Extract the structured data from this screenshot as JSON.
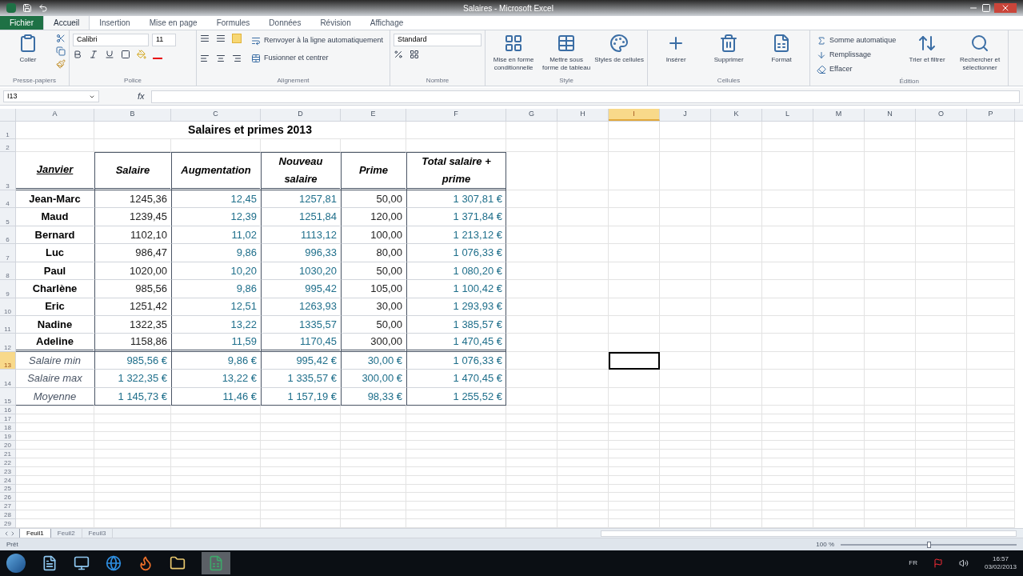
{
  "window": {
    "title": "Salaires - Microsoft Excel"
  },
  "ribbon": {
    "tabs": [
      {
        "label": "Fichier",
        "selected": false,
        "kind": "file"
      },
      {
        "label": "Accueil",
        "selected": true,
        "kind": "tab"
      },
      {
        "label": "Insertion",
        "selected": false,
        "kind": "tab"
      },
      {
        "label": "Mise en page",
        "selected": false,
        "kind": "tab"
      },
      {
        "label": "Formules",
        "selected": false,
        "kind": "tab"
      },
      {
        "label": "Données",
        "selected": false,
        "kind": "tab"
      },
      {
        "label": "Révision",
        "selected": false,
        "kind": "tab"
      },
      {
        "label": "Affichage",
        "selected": false,
        "kind": "tab"
      }
    ],
    "clipboard": {
      "paste": "Coller",
      "group": "Presse-papiers"
    },
    "font": {
      "name": "Calibri",
      "size": "11",
      "group": "Police"
    },
    "alignment": {
      "wrap": "Renvoyer à la ligne automatiquement",
      "merge": "Fusionner et centrer",
      "group": "Alignement"
    },
    "number": {
      "format": "Standard",
      "group": "Nombre"
    },
    "styles": {
      "buttons": [
        "Mise en forme conditionnelle",
        "Mettre sous forme de tableau",
        "Styles de cellules"
      ],
      "group": "Style"
    },
    "cells": {
      "buttons": [
        "Insérer",
        "Supprimer",
        "Format"
      ],
      "group": "Cellules"
    },
    "editing": {
      "commands": [
        "Somme automatique",
        "Remplissage",
        "Effacer"
      ],
      "buttons": [
        "Trier et filtrer",
        "Rechercher et sélectionner"
      ],
      "group": "Édition"
    }
  },
  "formula_bar": {
    "name_box": "I13",
    "function_label": "fx"
  },
  "grid": {
    "columns": [
      {
        "label": "A",
        "selected": false
      },
      {
        "label": "B",
        "selected": false
      },
      {
        "label": "C",
        "selected": false
      },
      {
        "label": "D",
        "selected": false
      },
      {
        "label": "E",
        "selected": false
      },
      {
        "label": "F",
        "selected": false
      },
      {
        "label": "G",
        "selected": false
      },
      {
        "label": "H",
        "selected": false
      },
      {
        "label": "I",
        "selected": true
      },
      {
        "label": "J",
        "selected": false
      },
      {
        "label": "K",
        "selected": false
      },
      {
        "label": "L",
        "selected": false
      },
      {
        "label": "M",
        "selected": false
      },
      {
        "label": "N",
        "selected": false
      },
      {
        "label": "O",
        "selected": false
      },
      {
        "label": "P",
        "selected": false
      }
    ],
    "computed_columns": [
      false,
      false,
      true,
      true,
      false,
      true
    ],
    "rows": [
      {
        "label": "1",
        "selected": false,
        "kind": "title",
        "cells": [
          "Salaires et primes 2013"
        ]
      },
      {
        "label": "2",
        "selected": false,
        "kind": "empty"
      },
      {
        "label": "3",
        "selected": false,
        "kind": "header",
        "cells": [
          "Janvier",
          "Salaire",
          "Augmentation",
          "Nouveau salaire",
          "Prime",
          "Total salaire + prime"
        ]
      },
      {
        "label": "4",
        "selected": false,
        "kind": "data",
        "cells": [
          "Jean-Marc",
          "1245,36",
          "12,45",
          "1257,81",
          "50,00",
          "1 307,81 €"
        ]
      },
      {
        "label": "5",
        "selected": false,
        "kind": "data",
        "cells": [
          "Maud",
          "1239,45",
          "12,39",
          "1251,84",
          "120,00",
          "1 371,84 €"
        ]
      },
      {
        "label": "6",
        "selected": false,
        "kind": "data",
        "cells": [
          "Bernard",
          "1102,10",
          "11,02",
          "1113,12",
          "100,00",
          "1 213,12 €"
        ]
      },
      {
        "label": "7",
        "selected": false,
        "kind": "data",
        "cells": [
          "Luc",
          "986,47",
          "9,86",
          "996,33",
          "80,00",
          "1 076,33 €"
        ]
      },
      {
        "label": "8",
        "selected": false,
        "kind": "data",
        "cells": [
          "Paul",
          "1020,00",
          "10,20",
          "1030,20",
          "50,00",
          "1 080,20 €"
        ]
      },
      {
        "label": "9",
        "selected": false,
        "kind": "data",
        "cells": [
          "Charlène",
          "985,56",
          "9,86",
          "995,42",
          "105,00",
          "1 100,42 €"
        ]
      },
      {
        "label": "10",
        "selected": false,
        "kind": "data",
        "cells": [
          "Eric",
          "1251,42",
          "12,51",
          "1263,93",
          "30,00",
          "1 293,93 €"
        ]
      },
      {
        "label": "11",
        "selected": false,
        "kind": "data",
        "cells": [
          "Nadine",
          "1322,35",
          "13,22",
          "1335,57",
          "50,00",
          "1 385,57 €"
        ]
      },
      {
        "label": "12",
        "selected": false,
        "kind": "data",
        "cells": [
          "Adeline",
          "1158,86",
          "11,59",
          "1170,45",
          "300,00",
          "1 470,45 €"
        ]
      },
      {
        "label": "13",
        "selected": true,
        "kind": "summary",
        "cells": [
          "Salaire min",
          "985,56 €",
          "9,86 €",
          "995,42 €",
          "30,00 €",
          "1 076,33 €"
        ]
      },
      {
        "label": "14",
        "selected": false,
        "kind": "summary",
        "cells": [
          "Salaire max",
          "1 322,35 €",
          "13,22 €",
          "1 335,57 €",
          "300,00 €",
          "1 470,45 €"
        ]
      },
      {
        "label": "15",
        "selected": false,
        "kind": "summary",
        "cells": [
          "Moyenne",
          "1 145,73 €",
          "11,46 €",
          "1 157,19 €",
          "98,33 €",
          "1 255,52 €"
        ]
      },
      {
        "label": "16",
        "selected": false,
        "kind": "empty"
      },
      {
        "label": "17",
        "selected": false,
        "kind": "empty"
      },
      {
        "label": "18",
        "selected": false,
        "kind": "empty"
      },
      {
        "label": "19",
        "selected": false,
        "kind": "empty"
      },
      {
        "label": "20",
        "selected": false,
        "kind": "empty"
      },
      {
        "label": "21",
        "selected": false,
        "kind": "empty"
      },
      {
        "label": "22",
        "selected": false,
        "kind": "empty"
      },
      {
        "label": "23",
        "selected": false,
        "kind": "empty"
      },
      {
        "label": "24",
        "selected": false,
        "kind": "empty"
      },
      {
        "label": "25",
        "selected": false,
        "kind": "empty"
      },
      {
        "label": "26",
        "selected": false,
        "kind": "empty"
      },
      {
        "label": "27",
        "selected": false,
        "kind": "empty"
      },
      {
        "label": "28",
        "selected": false,
        "kind": "empty"
      },
      {
        "label": "29",
        "selected": false,
        "kind": "empty"
      }
    ]
  },
  "sheet_tabs": [
    {
      "label": "Feuil1",
      "selected": true
    },
    {
      "label": "Feuil2",
      "selected": false
    },
    {
      "label": "Feuil3",
      "selected": false
    }
  ],
  "status_bar": {
    "status": "Prêt",
    "zoom": "100 %",
    "zoom_slider": {
      "level": 0.5
    }
  },
  "taskbar": {
    "language": "FR",
    "time": "16:57",
    "date": "03/02/2013"
  }
}
